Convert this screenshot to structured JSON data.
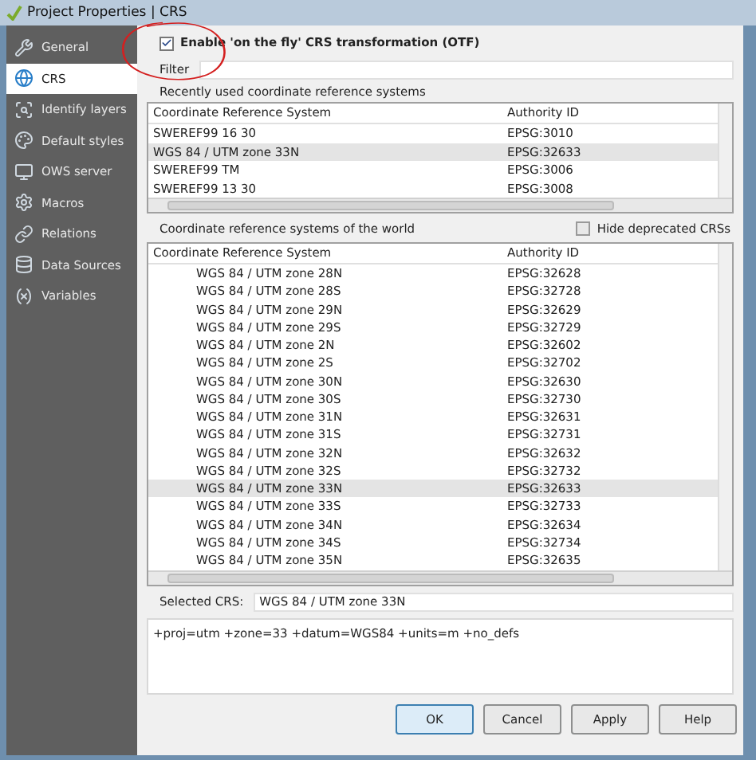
{
  "window": {
    "title": "Project Properties | CRS"
  },
  "sidebar": {
    "items": [
      {
        "label": "General",
        "selected": false
      },
      {
        "label": "CRS",
        "selected": true
      },
      {
        "label": "Identify layers",
        "selected": false
      },
      {
        "label": "Default styles",
        "selected": false
      },
      {
        "label": "OWS server",
        "selected": false
      },
      {
        "label": "Macros",
        "selected": false
      },
      {
        "label": "Relations",
        "selected": false
      },
      {
        "label": "Data Sources",
        "selected": false
      },
      {
        "label": "Variables",
        "selected": false
      }
    ]
  },
  "otf": {
    "label": "Enable 'on the fly' CRS transformation (OTF)",
    "checked": true
  },
  "filter": {
    "label": "Filter"
  },
  "recent": {
    "label": "Recently used coordinate reference systems",
    "columns": [
      "Coordinate Reference System",
      "Authority ID"
    ],
    "rows": [
      {
        "name": "SWEREF99 16 30",
        "id": "EPSG:3010",
        "selected": false
      },
      {
        "name": "WGS 84 / UTM zone 33N",
        "id": "EPSG:32633",
        "selected": true
      },
      {
        "name": "SWEREF99 TM",
        "id": "EPSG:3006",
        "selected": false
      },
      {
        "name": "SWEREF99 13 30",
        "id": "EPSG:3008",
        "selected": false
      }
    ]
  },
  "world": {
    "label": "Coordinate reference systems of the world",
    "hide_deprecated": {
      "label": "Hide deprecated CRSs",
      "checked": false
    },
    "columns": [
      "Coordinate Reference System",
      "Authority ID"
    ],
    "rows": [
      {
        "name": "WGS 84 / UTM zone 28N",
        "id": "EPSG:32628",
        "selected": false
      },
      {
        "name": "WGS 84 / UTM zone 28S",
        "id": "EPSG:32728",
        "selected": false
      },
      {
        "name": "WGS 84 / UTM zone 29N",
        "id": "EPSG:32629",
        "selected": false
      },
      {
        "name": "WGS 84 / UTM zone 29S",
        "id": "EPSG:32729",
        "selected": false
      },
      {
        "name": "WGS 84 / UTM zone 2N",
        "id": "EPSG:32602",
        "selected": false
      },
      {
        "name": "WGS 84 / UTM zone 2S",
        "id": "EPSG:32702",
        "selected": false
      },
      {
        "name": "WGS 84 / UTM zone 30N",
        "id": "EPSG:32630",
        "selected": false
      },
      {
        "name": "WGS 84 / UTM zone 30S",
        "id": "EPSG:32730",
        "selected": false
      },
      {
        "name": "WGS 84 / UTM zone 31N",
        "id": "EPSG:32631",
        "selected": false
      },
      {
        "name": "WGS 84 / UTM zone 31S",
        "id": "EPSG:32731",
        "selected": false
      },
      {
        "name": "WGS 84 / UTM zone 32N",
        "id": "EPSG:32632",
        "selected": false
      },
      {
        "name": "WGS 84 / UTM zone 32S",
        "id": "EPSG:32732",
        "selected": false
      },
      {
        "name": "WGS 84 / UTM zone 33N",
        "id": "EPSG:32633",
        "selected": true
      },
      {
        "name": "WGS 84 / UTM zone 33S",
        "id": "EPSG:32733",
        "selected": false
      },
      {
        "name": "WGS 84 / UTM zone 34N",
        "id": "EPSG:32634",
        "selected": false
      },
      {
        "name": "WGS 84 / UTM zone 34S",
        "id": "EPSG:32734",
        "selected": false
      },
      {
        "name": "WGS 84 / UTM zone 35N",
        "id": "EPSG:32635",
        "selected": false
      }
    ]
  },
  "selected_crs": {
    "label": "Selected CRS:",
    "value": "WGS 84 / UTM zone 33N"
  },
  "proj_string": "+proj=utm +zone=33 +datum=WGS84 +units=m +no_defs",
  "buttons": [
    {
      "label": "OK",
      "default": true
    },
    {
      "label": "Cancel",
      "default": false
    },
    {
      "label": "Apply",
      "default": false
    },
    {
      "label": "Help",
      "default": false
    }
  ]
}
